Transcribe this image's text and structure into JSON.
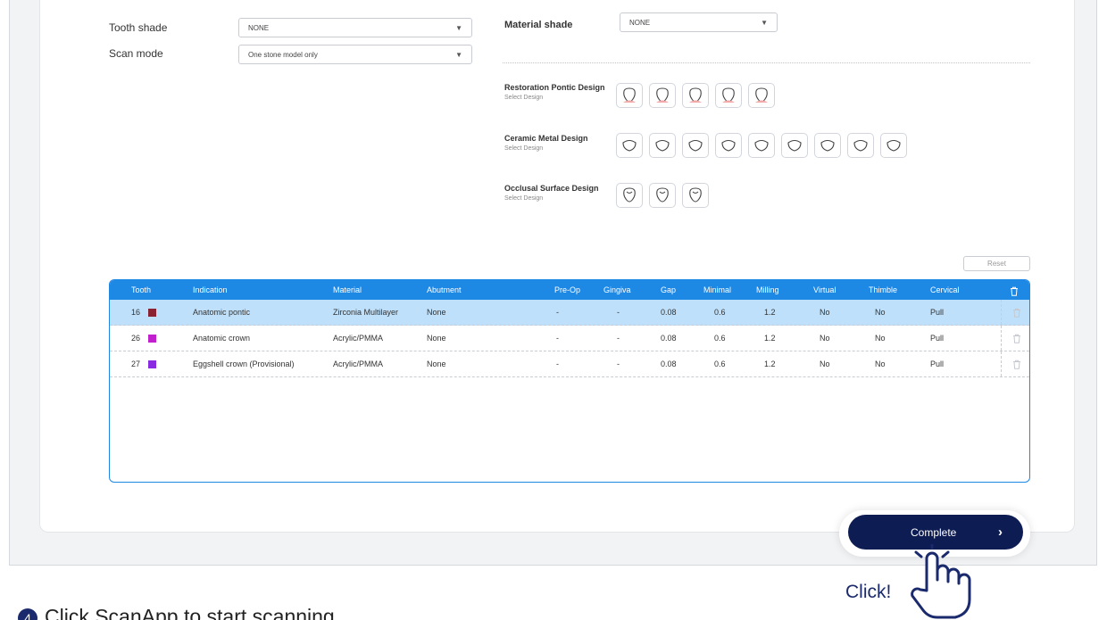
{
  "form": {
    "tooth_shade_label": "Tooth shade",
    "tooth_shade_value": "NONE",
    "scan_mode_label": "Scan mode",
    "scan_mode_value": "One stone model only",
    "material_shade_label": "Material shade",
    "material_shade_value": "NONE"
  },
  "designs": {
    "restoration_pontic": {
      "title": "Restoration Pontic Design",
      "sub": "Select Design"
    },
    "ceramic_metal": {
      "title": "Ceramic Metal Design",
      "sub": "Select Design"
    },
    "occlusal_surface": {
      "title": "Occlusal Surface Design",
      "sub": "Select Design"
    }
  },
  "reset_label": "Reset",
  "table": {
    "headers": [
      "Tooth",
      "Indication",
      "Material",
      "Abutment",
      "Pre-Op",
      "Gingiva",
      "Gap",
      "Minimal",
      "Milling",
      "Virtual",
      "Thimble",
      "Cervical"
    ],
    "rows": [
      {
        "tooth": "16",
        "color": "#8b2232",
        "indication": "Anatomic pontic",
        "material": "Zirconia Multilayer",
        "abutment": "None",
        "preop": "-",
        "gingiva": "-",
        "gap": "0.08",
        "minimal": "0.6",
        "milling": "1.2",
        "virtual": "No",
        "thimble": "No",
        "cervical": "Pull"
      },
      {
        "tooth": "26",
        "color": "#c21fcf",
        "indication": "Anatomic crown",
        "material": "Acrylic/PMMA",
        "abutment": "None",
        "preop": "-",
        "gingiva": "-",
        "gap": "0.08",
        "minimal": "0.6",
        "milling": "1.2",
        "virtual": "No",
        "thimble": "No",
        "cervical": "Pull"
      },
      {
        "tooth": "27",
        "color": "#8a2be2",
        "indication": "Eggshell crown (Provisional)",
        "material": "Acrylic/PMMA",
        "abutment": "None",
        "preop": "-",
        "gingiva": "-",
        "gap": "0.08",
        "minimal": "0.6",
        "milling": "1.2",
        "virtual": "No",
        "thimble": "No",
        "cervical": "Pull"
      }
    ]
  },
  "complete_label": "Complete",
  "click_label": "Click!",
  "caption": {
    "step": "4",
    "text": "Click ScanApp to start scanning"
  },
  "colors": {
    "accent": "#1e88e5",
    "selected_row": "#bfe0fa",
    "button": "#0d1c52"
  }
}
